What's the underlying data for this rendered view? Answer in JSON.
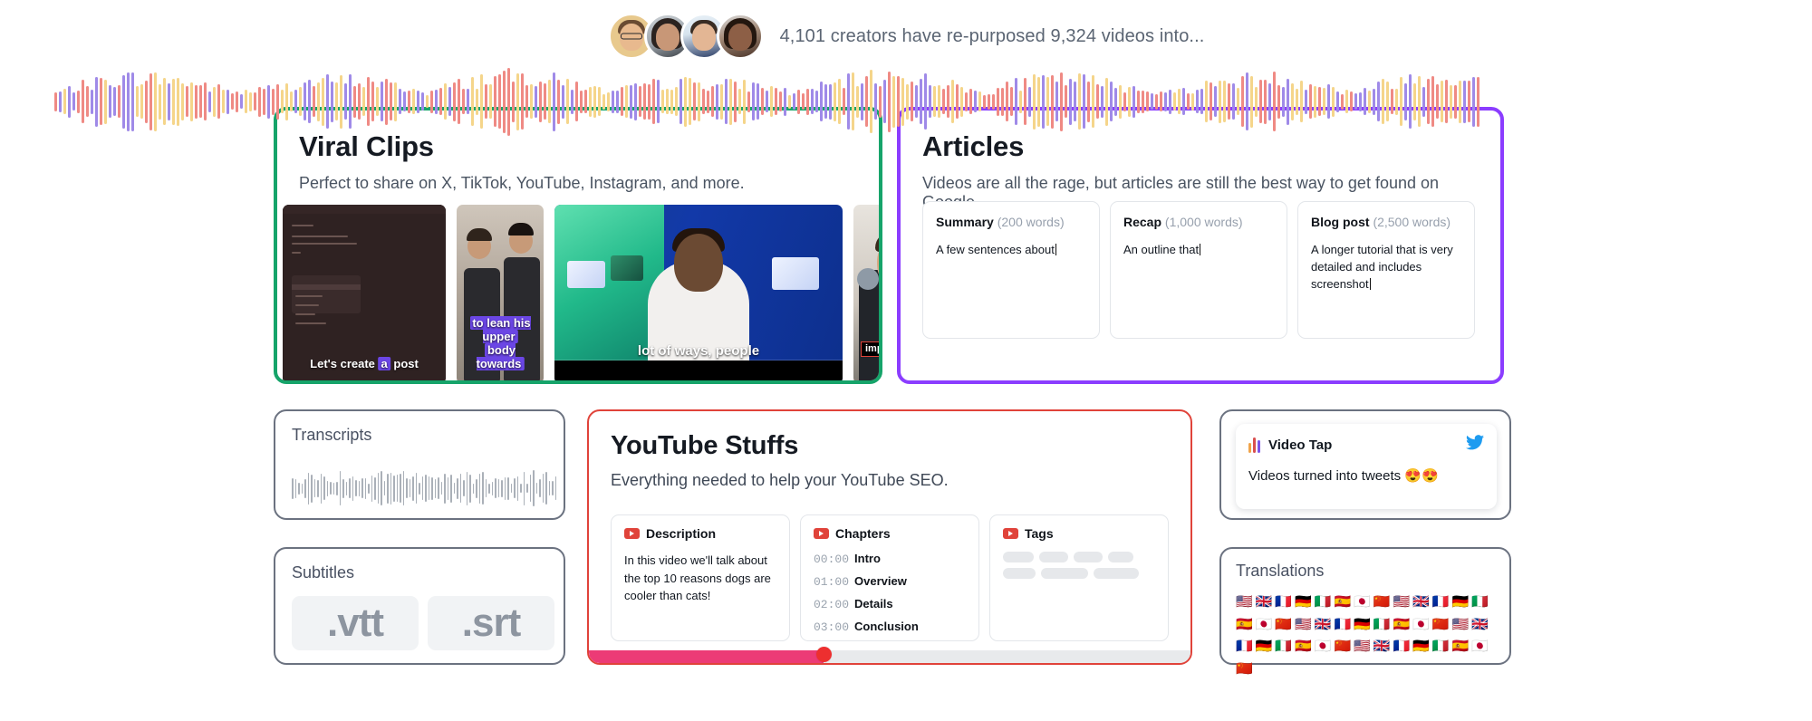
{
  "header": {
    "stat_text": "4,101 creators have re-purposed 9,324 videos into...",
    "avatars": [
      "creator-avatar-1",
      "creator-avatar-2",
      "creator-avatar-3",
      "creator-avatar-4"
    ]
  },
  "colors": {
    "viral_clips_border": "#16a46a",
    "articles_border": "#8b3dff",
    "youtube_border": "#e0433a",
    "neutral_border": "#6b7280",
    "progress_fill": "#ec3b76",
    "progress_knob": "#ed2f2f",
    "wave_red": "#ef8a84",
    "wave_yellow": "#f5d58a",
    "wave_purple": "#9f8ae8"
  },
  "cards": {
    "viral_clips": {
      "title": "Viral Clips",
      "subtitle": "Perfect to share on X, TikTok, YouTube, Instagram, and more.",
      "clips": [
        {
          "name": "clip-code-editor",
          "caption_pre": "Let's create ",
          "caption_hl": "a",
          "caption_post": " post"
        },
        {
          "name": "clip-two-men",
          "caption_line1": "to lean his upper",
          "caption_line2": "body towards"
        },
        {
          "name": "clip-studio-host",
          "caption": "lot of ways, people"
        },
        {
          "name": "clip-man-device",
          "caption": "improvement"
        }
      ]
    },
    "articles": {
      "title": "Articles",
      "subtitle": "Videos are all the rage, but articles are still the best way to get found on Google.",
      "boxes": [
        {
          "name": "Summary",
          "words": "(200 words)",
          "body": "A few sentences about"
        },
        {
          "name": "Recap",
          "words": "(1,000 words)",
          "body": "An outline that"
        },
        {
          "name": "Blog post",
          "words": "(2,500 words)",
          "body": "A longer tutorial that is very detailed and includes screenshot"
        }
      ]
    },
    "transcripts": {
      "title": "Transcripts"
    },
    "subtitles": {
      "title": "Subtitles",
      "formats": [
        ".vtt",
        ".srt"
      ]
    },
    "youtube": {
      "title": "YouTube Stuffs",
      "subtitle": "Everything needed to help your YouTube SEO.",
      "description": {
        "heading": "Description",
        "body": "In this video we'll talk about the top 10 reasons dogs are cooler than cats!"
      },
      "chapters": {
        "heading": "Chapters",
        "items": [
          {
            "time": "00:00",
            "label": "Intro"
          },
          {
            "time": "01:00",
            "label": "Overview"
          },
          {
            "time": "02:00",
            "label": "Details"
          },
          {
            "time": "03:00",
            "label": "Conclusion"
          }
        ]
      },
      "tags": {
        "heading": "Tags",
        "placeholder_widths": [
          34,
          32,
          32,
          28,
          36,
          52,
          50
        ]
      },
      "progress_percent": 39
    },
    "video_tap": {
      "title": "Video Tap",
      "tweet_text": "Videos turned into tweets 😍😍",
      "network_icon": "twitter-bird-icon"
    },
    "translations": {
      "title": "Translations",
      "flags": [
        "🇺🇸",
        "🇬🇧",
        "🇫🇷",
        "🇩🇪",
        "🇮🇹",
        "🇪🇸",
        "🇯🇵",
        "🇨🇳",
        "🇺🇸",
        "🇬🇧",
        "🇫🇷",
        "🇩🇪",
        "🇮🇹",
        "🇪🇸",
        "🇯🇵",
        "🇨🇳",
        "🇺🇸",
        "🇬🇧",
        "🇫🇷",
        "🇩🇪",
        "🇮🇹",
        "🇪🇸",
        "🇯🇵",
        "🇨🇳",
        "🇺🇸",
        "🇬🇧",
        "🇫🇷",
        "🇩🇪",
        "🇮🇹",
        "🇪🇸",
        "🇯🇵",
        "🇨🇳",
        "🇺🇸",
        "🇬🇧",
        "🇫🇷",
        "🇩🇪",
        "🇮🇹",
        "🇪🇸",
        "🇯🇵",
        "🇨🇳"
      ]
    }
  }
}
